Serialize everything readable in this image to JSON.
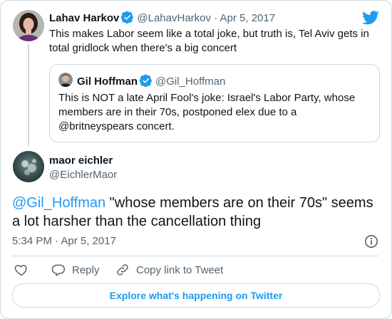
{
  "parent_tweet": {
    "author_name": "Lahav Harkov",
    "handle_date": "@LahavHarkov · Apr 5, 2017",
    "text_line1": "This makes Labor seem like a total joke, but truth is, Tel Aviv gets in",
    "text_line2": "total gridlock when there's a big concert"
  },
  "quoted_tweet": {
    "author_name": "Gil Hoffman",
    "handle": "@Gil_Hoffman",
    "text_line1": "This is NOT a late April Fool's joke: Israel's Labor Party, whose",
    "text_line2": "members are in their 70s, postponed elex due to a",
    "text_line3": "@britneyspears concert."
  },
  "main_tweet": {
    "author_name": "maor eichler",
    "handle": "@EichlerMaor",
    "mention": "@Gil_Hoffman",
    "text_line1_rest": " \"whose members are on their 70s\" seems",
    "text_line2": "a lot harsher than the cancellation thing",
    "timestamp": "5:34 PM · Apr 5, 2017"
  },
  "actions": {
    "reply_label": "Reply",
    "copy_label": "Copy link to Tweet"
  },
  "explore_label": "Explore what's happening on Twitter",
  "colors": {
    "accent": "#1d9bf0",
    "verified": "#1d9bf0",
    "border": "#cfd9de",
    "secondary_text": "#536471"
  },
  "icons": [
    "twitter-bird-icon",
    "verified-badge-icon",
    "info-icon",
    "heart-icon",
    "reply-icon",
    "link-icon"
  ]
}
